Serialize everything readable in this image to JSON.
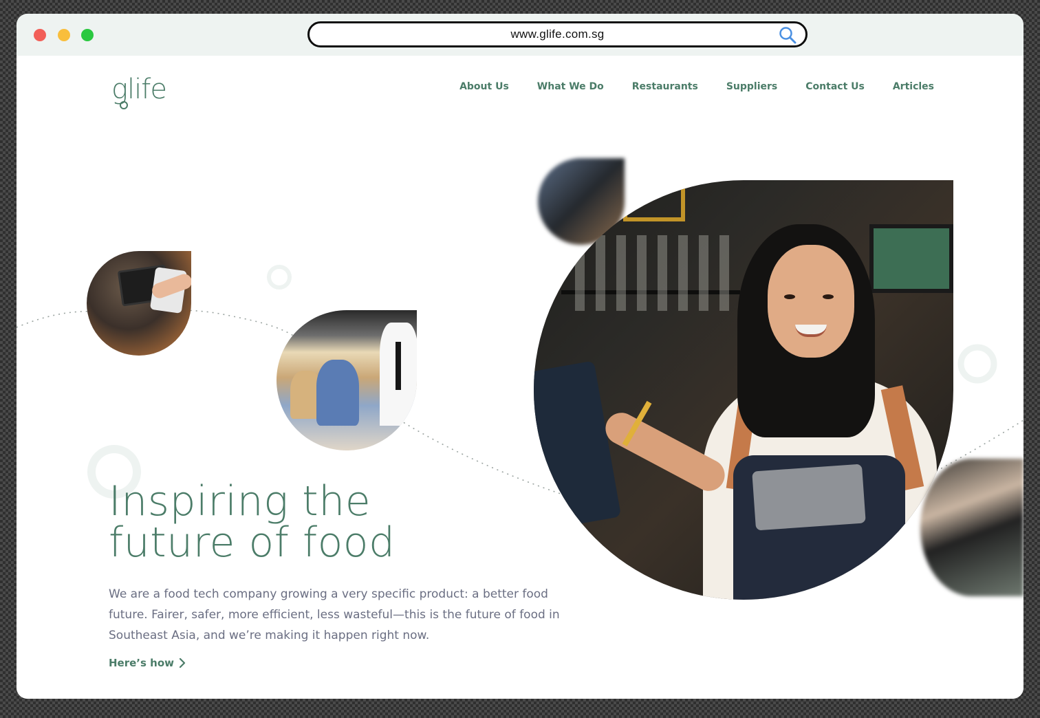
{
  "browser": {
    "url": "www.glife.com.sg",
    "search_icon": "search-icon"
  },
  "brand": {
    "logo_text": "glife",
    "accent_color": "#4b7c68"
  },
  "nav": {
    "items": [
      {
        "label": "About Us"
      },
      {
        "label": "What We Do"
      },
      {
        "label": "Restaurants"
      },
      {
        "label": "Suppliers"
      },
      {
        "label": "Contact Us"
      },
      {
        "label": "Articles"
      }
    ]
  },
  "hero": {
    "title_line1": "Inspiring the",
    "title_line2": "future of food",
    "description": "We are a food tech company growing a very specific product: a better food future. Fairer, safer, more efficient, less wasteful—this is the future of food in Southeast Asia, and we’re making it happen right now.",
    "cta_label": "Here’s how",
    "cta_icon": "chevron-right-icon"
  }
}
